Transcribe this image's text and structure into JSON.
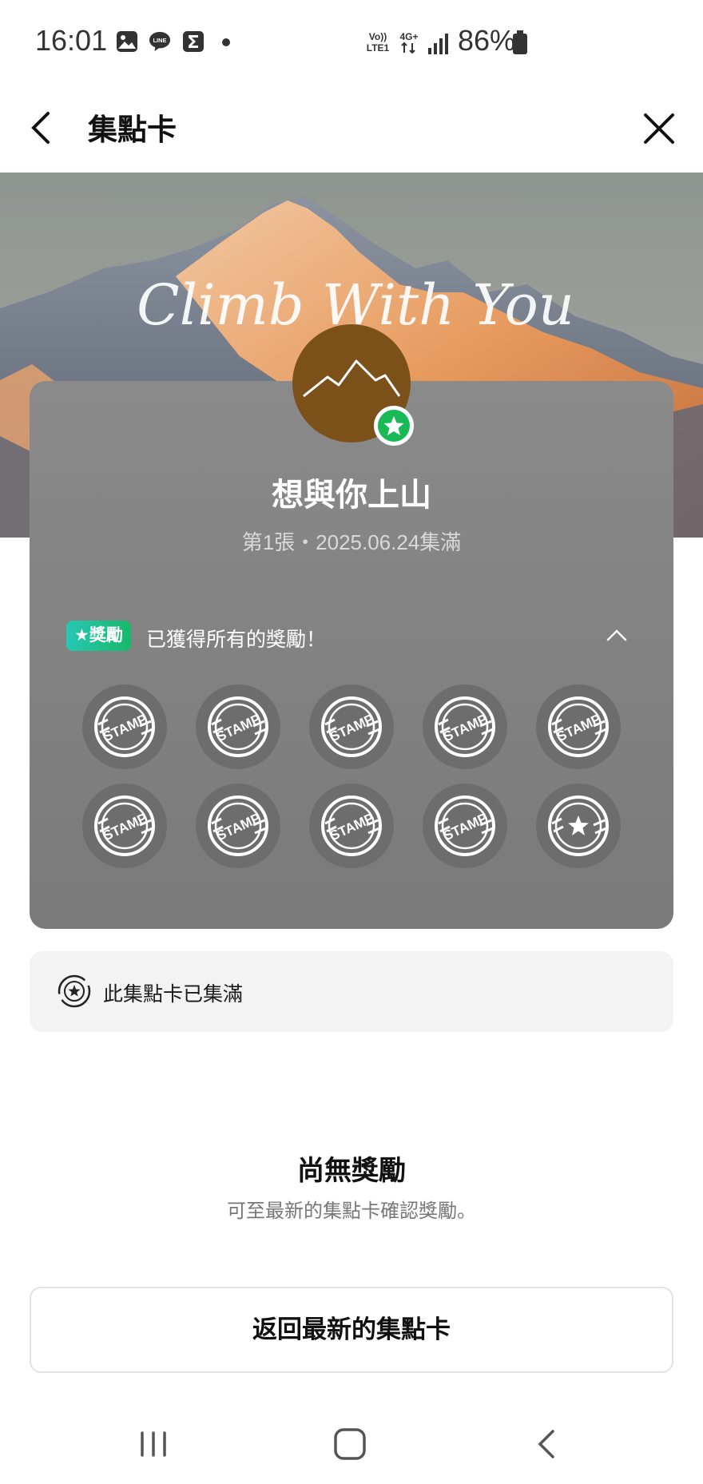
{
  "status_bar": {
    "time": "16:01",
    "icons": [
      "gallery-icon",
      "line-icon",
      "sigma-icon",
      "dot"
    ],
    "network": [
      "volte-lte1",
      "4g-plus-arrows",
      "signal-bars"
    ],
    "battery": "86%"
  },
  "header": {
    "title": "集點卡",
    "back_icon": "chevron-left-icon",
    "close_icon": "close-icon"
  },
  "banner": {
    "script_text": "Climb With You",
    "image": "snow-mountain-sunset"
  },
  "card": {
    "title": "想與你上山",
    "subtitle": "第1張・2025.06.24集滿",
    "avatar": "mountain-avatar",
    "badge_icon": "star-badge-icon",
    "reward_badge": "★獎勵",
    "reward_text": "已獲得所有的獎勵！",
    "collapse_icon": "chevron-up-icon",
    "stamp_label": "STAMP",
    "stamps": [
      {
        "type": "stamp"
      },
      {
        "type": "stamp"
      },
      {
        "type": "stamp"
      },
      {
        "type": "stamp"
      },
      {
        "type": "stamp"
      },
      {
        "type": "stamp"
      },
      {
        "type": "stamp"
      },
      {
        "type": "stamp"
      },
      {
        "type": "stamp"
      },
      {
        "type": "star"
      }
    ]
  },
  "complete_notice": {
    "icon": "complete-stamp-icon",
    "text": "此集點卡已集滿"
  },
  "empty_reward": {
    "title": "尚無獎勵",
    "subtitle": "可至最新的集點卡確認獎勵。"
  },
  "return_button": "返回最新的集點卡",
  "nav_bar": [
    "recent-apps-icon",
    "home-icon",
    "back-icon"
  ],
  "colors": {
    "card_bg": "#828282",
    "reward_gradient_start": "#27c7b4",
    "reward_gradient_end": "#18b86a",
    "avatar_bg": "#7b5019",
    "badge_green": "#19b955"
  }
}
